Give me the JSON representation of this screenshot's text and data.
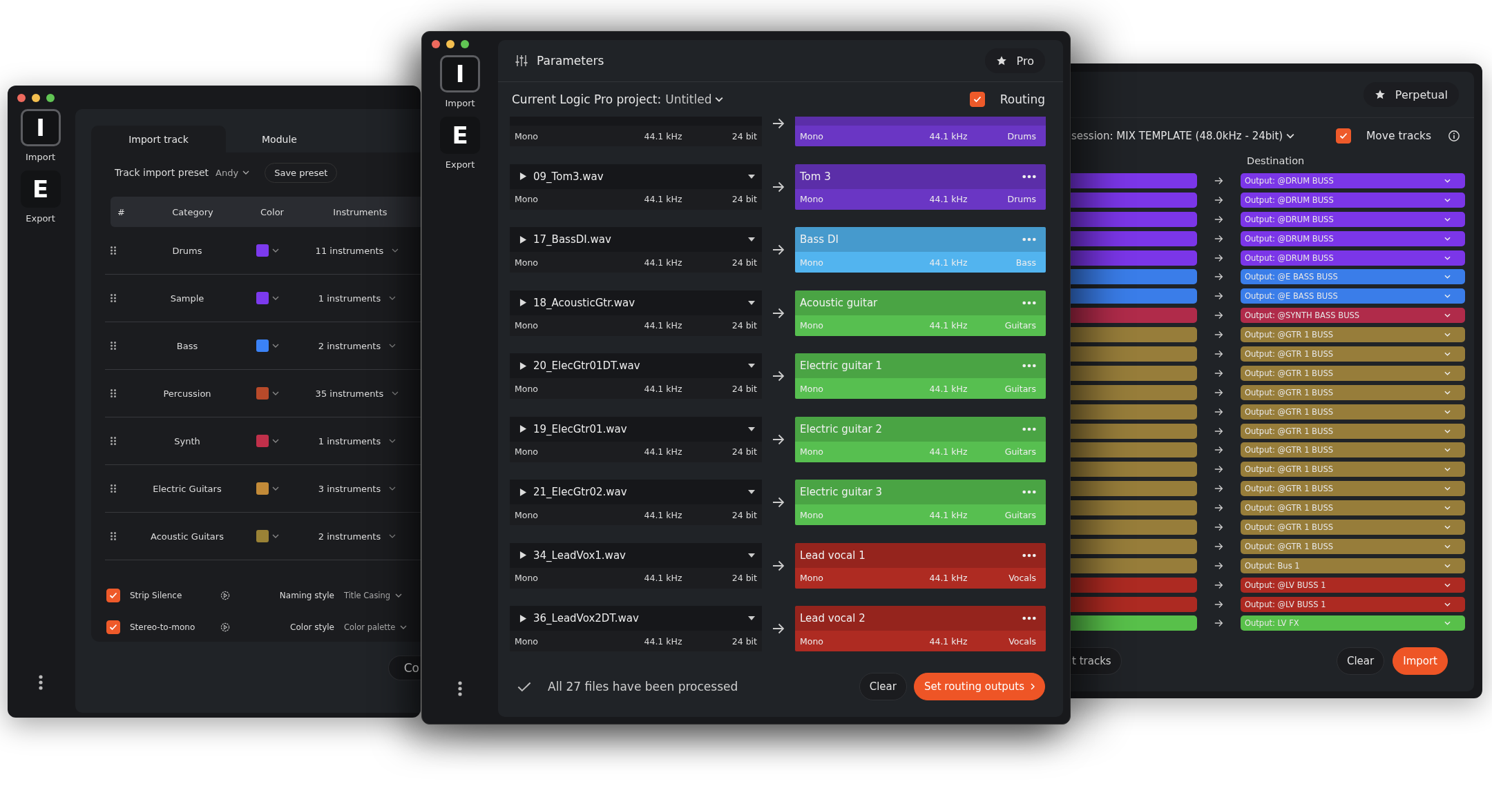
{
  "left_window": {
    "sidebar": [
      {
        "letter": "I",
        "label": "Import",
        "selected": true
      },
      {
        "letter": "E",
        "label": "Export",
        "selected": false
      }
    ],
    "tabs": [
      {
        "label": "Import track",
        "selected": true
      },
      {
        "label": "Module",
        "selected": false
      }
    ],
    "preset": {
      "label": "Track import preset",
      "value": "Andy",
      "save_button": "Save preset"
    },
    "table": {
      "columns": [
        "#",
        "Category",
        "Color",
        "Instruments"
      ],
      "rows": [
        {
          "category": "Drums",
          "color": "#7c3aed",
          "instruments": "11 instruments"
        },
        {
          "category": "Sample",
          "color": "#7c3aed",
          "instruments": "1 instruments"
        },
        {
          "category": "Bass",
          "color": "#3b82f6",
          "instruments": "2 instruments"
        },
        {
          "category": "Percussion",
          "color": "#b84a2a",
          "instruments": "35 instruments"
        },
        {
          "category": "Synth",
          "color": "#c0304a",
          "instruments": "1 instruments"
        },
        {
          "category": "Electric Guitars",
          "color": "#c28a38",
          "instruments": "3 instruments"
        },
        {
          "category": "Acoustic Guitars",
          "color": "#9a8236",
          "instruments": "2 instruments"
        }
      ]
    },
    "options": [
      {
        "label": "Strip Silence",
        "checked": true,
        "setting_label": "Naming style",
        "setting_value": "Title Casing"
      },
      {
        "label": "Stereo-to-mono",
        "checked": true,
        "setting_label": "Color style",
        "setting_value": "Color palette"
      }
    ],
    "cut_button": "Co"
  },
  "center_window": {
    "sidebar": [
      {
        "letter": "I",
        "label": "Import",
        "selected": true
      },
      {
        "letter": "E",
        "label": "Export",
        "selected": false
      }
    ],
    "title": "Parameters",
    "plan": "Pro",
    "project": {
      "label": "Current Logic Pro project:",
      "value": "Untitled"
    },
    "routing": {
      "label": "Routing",
      "checked": true
    },
    "tracks": [
      {
        "channels": "Mono",
        "rate": "44.1 kHz",
        "depth": "24 bit",
        "dest": {
          "channels": "Mono",
          "rate": "44.1 kHz",
          "category": "Drums",
          "color": "#6a36c4"
        }
      },
      {
        "name": "09_Tom3.wav",
        "channels": "Mono",
        "rate": "44.1 kHz",
        "depth": "24 bit",
        "dest": {
          "name": "Tom 3",
          "channels": "Mono",
          "rate": "44.1 kHz",
          "category": "Drums",
          "color": "#6a36c4"
        }
      },
      {
        "name": "17_BassDI.wav",
        "channels": "Mono",
        "rate": "44.1 kHz",
        "depth": "24 bit",
        "dest": {
          "name": "Bass DI",
          "channels": "Mono",
          "rate": "44.1 kHz",
          "category": "Bass",
          "color": "#52b4ef"
        }
      },
      {
        "name": "18_AcousticGtr.wav",
        "channels": "Mono",
        "rate": "44.1 kHz",
        "depth": "24 bit",
        "dest": {
          "name": "Acoustic guitar",
          "channels": "Mono",
          "rate": "44.1 kHz",
          "category": "Guitars",
          "color": "#57bf50"
        }
      },
      {
        "name": "20_ElecGtr01DT.wav",
        "channels": "Mono",
        "rate": "44.1 kHz",
        "depth": "24 bit",
        "dest": {
          "name": "Electric guitar 1",
          "channels": "Mono",
          "rate": "44.1 kHz",
          "category": "Guitars",
          "color": "#57bf50"
        }
      },
      {
        "name": "19_ElecGtr01.wav",
        "channels": "Mono",
        "rate": "44.1 kHz",
        "depth": "24 bit",
        "dest": {
          "name": "Electric guitar 2",
          "channels": "Mono",
          "rate": "44.1 kHz",
          "category": "Guitars",
          "color": "#57bf50"
        }
      },
      {
        "name": "21_ElecGtr02.wav",
        "channels": "Mono",
        "rate": "44.1 kHz",
        "depth": "24 bit",
        "dest": {
          "name": "Electric guitar 3",
          "channels": "Mono",
          "rate": "44.1 kHz",
          "category": "Guitars",
          "color": "#57bf50"
        }
      },
      {
        "name": "34_LeadVox1.wav",
        "channels": "Mono",
        "rate": "44.1 kHz",
        "depth": "24 bit",
        "dest": {
          "name": "Lead vocal 1",
          "channels": "Mono",
          "rate": "44.1 kHz",
          "category": "Vocals",
          "color": "#ae2b22"
        }
      },
      {
        "name": "36_LeadVox2DT.wav",
        "channels": "Mono",
        "rate": "44.1 kHz",
        "depth": "24 bit",
        "dest": {
          "name": "Lead vocal 2",
          "channels": "Mono",
          "rate": "44.1 kHz",
          "category": "Vocals",
          "color": "#ae2b22"
        }
      }
    ],
    "status": "All 27 files have been processed",
    "buttons": [
      {
        "label": "Clear",
        "kind": "secondary"
      },
      {
        "label": "Set routing outputs",
        "kind": "primary"
      }
    ]
  },
  "right_window": {
    "plan": "Perpetual",
    "session": "session: MIX TEMPLATE (48.0kHz - 24bit)",
    "move_tracks": {
      "label": "Move tracks",
      "checked": true
    },
    "destination_heading": "Destination",
    "routes": [
      {
        "color": "#7b36e8",
        "output": "Output: @DRUM BUSS"
      },
      {
        "color": "#7b36e8",
        "output": "Output: @DRUM BUSS"
      },
      {
        "color": "#7b36e8",
        "output": "Output: @DRUM BUSS"
      },
      {
        "color": "#7b36e8",
        "output": "Output: @DRUM BUSS"
      },
      {
        "color": "#7b36e8",
        "output": "Output: @DRUM BUSS"
      },
      {
        "color": "#3a7de9",
        "output": "Output: @E BASS BUSS"
      },
      {
        "color": "#3a7de9",
        "output": "Output: @E BASS BUSS"
      },
      {
        "color": "#b02b4a",
        "output": "Output: @SYNTH BASS BUSS"
      },
      {
        "color": "#977d3a",
        "output": "Output: @GTR 1 BUSS"
      },
      {
        "color": "#977d3a",
        "output": "Output: @GTR 1 BUSS"
      },
      {
        "color": "#977d3a",
        "output": "Output: @GTR 1 BUSS"
      },
      {
        "color": "#977d3a",
        "output": "Output: @GTR 1 BUSS"
      },
      {
        "color": "#977d3a",
        "output": "Output: @GTR 1 BUSS"
      },
      {
        "color": "#977d3a",
        "output": "Output: @GTR 1 BUSS"
      },
      {
        "color": "#977d3a",
        "output": "Output: @GTR 1 BUSS"
      },
      {
        "color": "#977d3a",
        "output": "Output: @GTR 1 BUSS"
      },
      {
        "color": "#977d3a",
        "output": "Output: @GTR 1 BUSS"
      },
      {
        "color": "#977d3a",
        "output": "Output: @GTR 1 BUSS"
      },
      {
        "color": "#977d3a",
        "output": "Output: @GTR 1 BUSS"
      },
      {
        "color": "#977d3a",
        "output": "Output: @GTR 1 BUSS"
      },
      {
        "color": "#977d3a",
        "output": "Output: Bus 1"
      },
      {
        "color": "#ad2a22",
        "output": "Output: @LV BUSS 1"
      },
      {
        "color": "#ad2a22",
        "output": "Output: @LV BUSS 1"
      },
      {
        "color": "#58c04a",
        "output": "Output: LV FX"
      }
    ],
    "buttons": [
      {
        "label": "t tracks",
        "kind": "cut"
      },
      {
        "label": "Clear",
        "kind": "secondary"
      },
      {
        "label": "Import",
        "kind": "primary"
      }
    ]
  }
}
